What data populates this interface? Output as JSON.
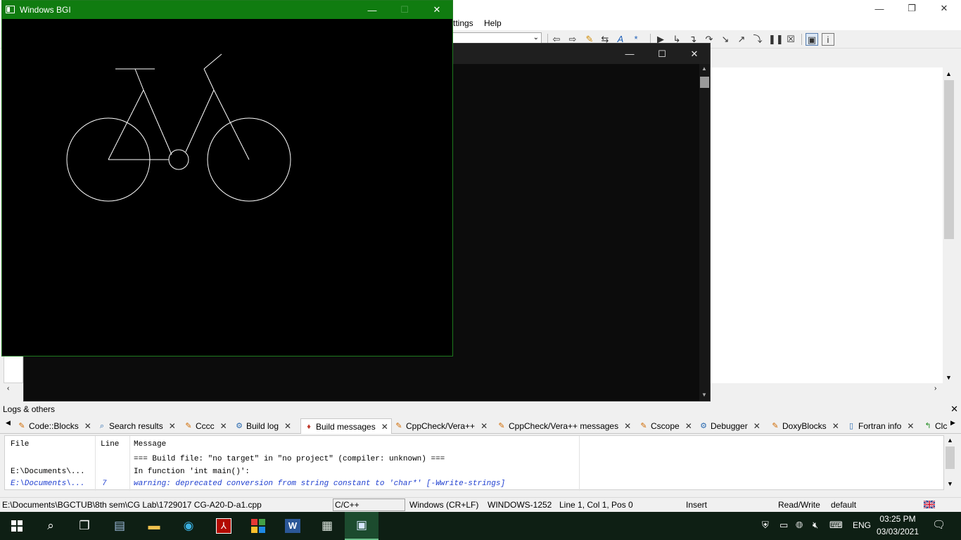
{
  "ide": {
    "menu": {
      "settings": "ttings",
      "help": "Help"
    },
    "controls": {
      "minimize": "—",
      "restore": "❐",
      "close": "✕"
    }
  },
  "bgi_window": {
    "title": "Windows BGI",
    "controls": {
      "minimize": "—",
      "maximize": "☐",
      "close": "✕"
    },
    "line_color": "#ffffff"
  },
  "console_window": {
    "title": "",
    "controls": {
      "minimize": "—",
      "maximize": "☐",
      "close": "✕"
    }
  },
  "logs": {
    "title": "Logs & others",
    "close": "✕",
    "tabs": [
      {
        "label": "Code::Blocks",
        "icon": "page-pencil-icon"
      },
      {
        "label": "Search results",
        "icon": "magnifier-icon"
      },
      {
        "label": "Cccc",
        "icon": "page-pencil-icon"
      },
      {
        "label": "Build log",
        "icon": "gear-icon"
      },
      {
        "label": "Build messages",
        "icon": "pin-icon",
        "active": true
      },
      {
        "label": "CppCheck/Vera++",
        "icon": "page-pencil-icon"
      },
      {
        "label": "CppCheck/Vera++ messages",
        "icon": "page-pencil-icon"
      },
      {
        "label": "Cscope",
        "icon": "page-pencil-icon"
      },
      {
        "label": "Debugger",
        "icon": "gear-icon"
      },
      {
        "label": "DoxyBlocks",
        "icon": "page-pencil-icon"
      },
      {
        "label": "Fortran info",
        "icon": "page-icon"
      },
      {
        "label": "Clc",
        "icon": "arrow-icon"
      }
    ],
    "columns": {
      "file": "File",
      "line": "Line",
      "message": "Message"
    },
    "rows": [
      {
        "file": "",
        "line": "",
        "message": "=== Build file: \"no target\" in \"no project\" (compiler: unknown) ===",
        "kind": "info"
      },
      {
        "file": "E:\\Documents\\...",
        "line": "",
        "message": "In function 'int main()':",
        "kind": "info"
      },
      {
        "file": "E:\\Documents\\...",
        "line": "7",
        "message": "warning: deprecated conversion from string constant to 'char*' [-Wwrite-strings]",
        "kind": "warning"
      }
    ]
  },
  "status": {
    "path": "E:\\Documents\\BGCTUB\\8th sem\\CG Lab\\1729017 CG-A20-D-a1.cpp",
    "language": "C/C++",
    "line_endings": "Windows (CR+LF)",
    "encoding": "WINDOWS-1252",
    "position": "Line 1, Col 1, Pos 0",
    "mode": "Insert",
    "access": "Read/Write",
    "profile": "default"
  },
  "taskbar": {
    "language": "ENG",
    "time": "03:25 PM",
    "date": "03/03/2021"
  }
}
